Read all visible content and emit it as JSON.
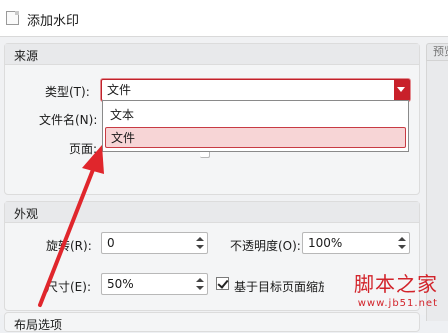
{
  "window": {
    "title": "添加水印"
  },
  "source_group": {
    "title": "来源",
    "type_label": "类型(T):",
    "type_value": "文件",
    "filename_label": "文件名(N):",
    "page_label": "页面:",
    "dropdown_options": [
      "文本",
      "文件"
    ],
    "selected_option": "文件"
  },
  "preview": {
    "tab_label": "预览"
  },
  "appearance_group": {
    "title": "外观",
    "rotation_label": "旋转(R):",
    "rotation_value": "0",
    "opacity_label": "不透明度(O):",
    "opacity_value": "100%",
    "size_label": "尺寸(E):",
    "size_value": "50%",
    "scale_checkbox_label": "基于目标页面缩放",
    "scale_checkbox_checked": true
  },
  "bottom_group": {
    "title": "布局选项"
  },
  "watermark_overlay": {
    "brand": "脚本之家",
    "url": "www.jb51.net"
  },
  "colors": {
    "accent_red": "#c9202a",
    "selection_bg": "#f7d5d6",
    "annotation_arrow": "#e0262c"
  }
}
